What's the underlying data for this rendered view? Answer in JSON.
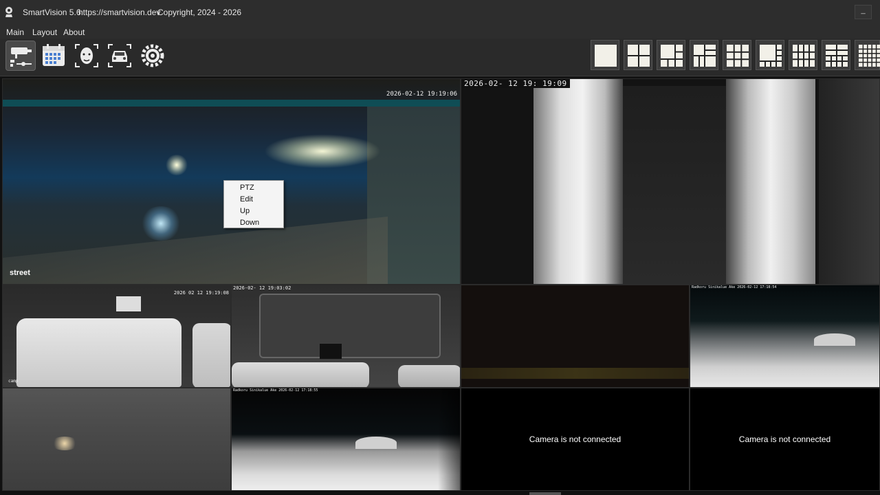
{
  "window": {
    "app_name": "SmartVision 5.6",
    "url": "https://smartvision.dev",
    "copyright": "Copyright, 2024 - 2026",
    "minimize_label": "_"
  },
  "menu": [
    "Main",
    "Layout",
    "About"
  ],
  "toolbar": {
    "tools": [
      "camera-settings-icon",
      "calendar-icon",
      "face-recognition-icon",
      "car-recognition-icon",
      "settings-gear-icon"
    ],
    "layouts": [
      "1x1",
      "2x2",
      "1+5",
      "1+3",
      "3x3",
      "1+7",
      "4x3",
      "4x4",
      "5x5"
    ]
  },
  "cameras": [
    {
      "id": "cam1",
      "timestamp": "2026-02-12 19:19:06",
      "label": "street"
    },
    {
      "id": "cam2",
      "timestamp": "2026-02- 12   19: 19:09"
    },
    {
      "id": "cam3",
      "timestamp": "2026 02 12 19:19:08",
      "label": "camp"
    },
    {
      "id": "cam4",
      "timestamp": "2026-02- 12   19:03:02"
    },
    {
      "id": "cam5"
    },
    {
      "id": "cam6",
      "timestamp": "Radkoru Sinikalue Ake 2026-02-12 17:18:54"
    },
    {
      "id": "cam7"
    },
    {
      "id": "cam8",
      "timestamp": "Radkoru Sinikalue Ake 2026-02-12 17:18:55"
    },
    {
      "id": "cam9",
      "status": "Camera is not connected"
    },
    {
      "id": "cam10",
      "status": "Camera is not connected"
    }
  ],
  "context_menu": [
    "PTZ",
    "Edit",
    "Up",
    "Down"
  ]
}
